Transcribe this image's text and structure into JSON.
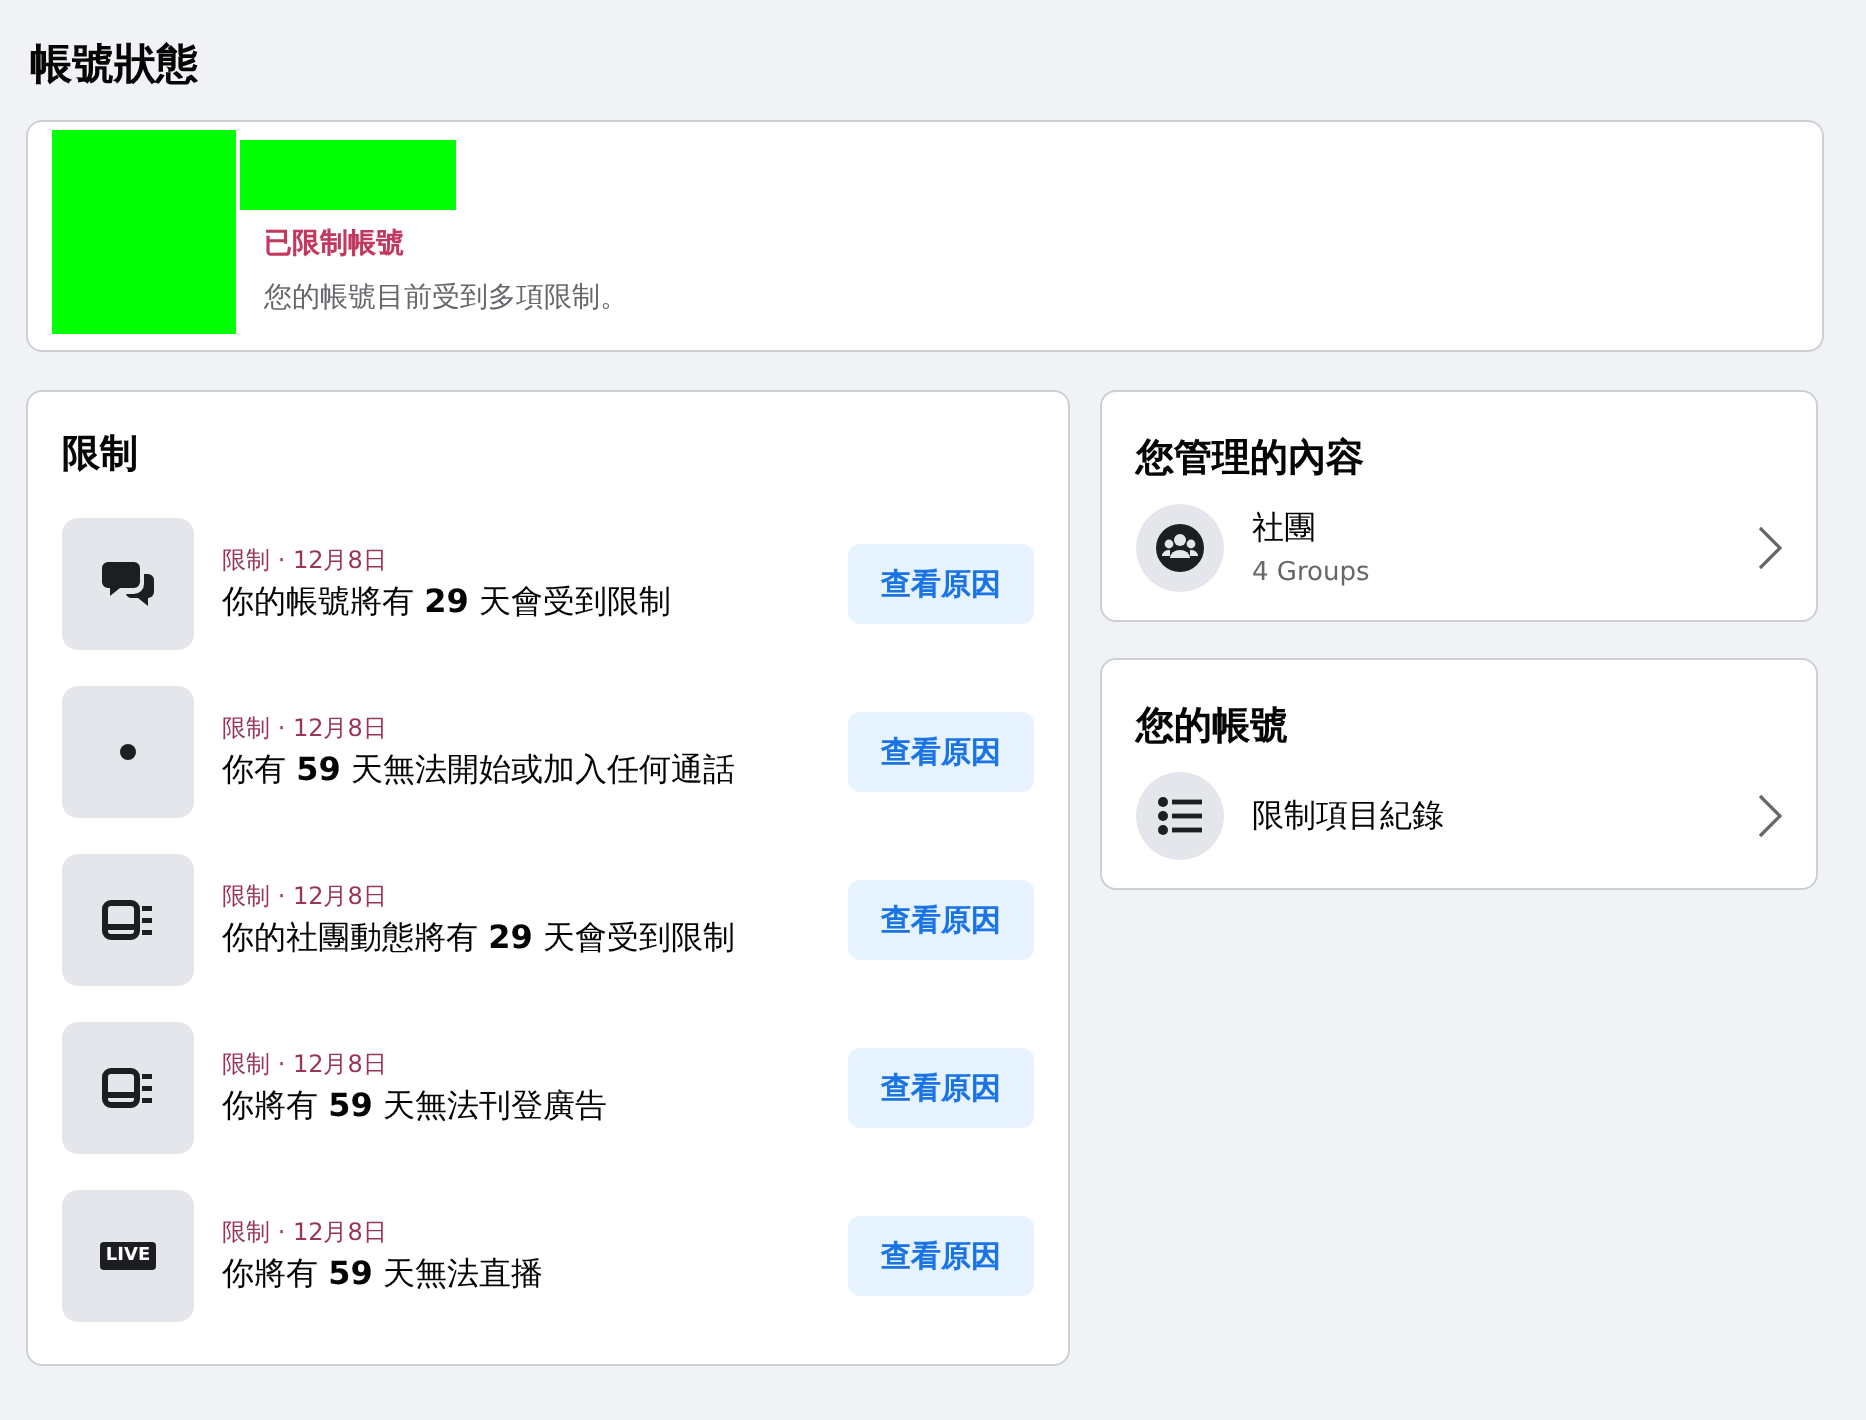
{
  "page_title": "帳號狀態",
  "account": {
    "status": "已限制帳號",
    "description": "您的帳號目前受到多項限制。"
  },
  "restrictions": {
    "title": "限制",
    "items": [
      {
        "kind": "chat",
        "meta": "限制 · 12月8日",
        "text": "你的帳號將有 **29** 天會受到限制",
        "button": "查看原因"
      },
      {
        "kind": "dot",
        "meta": "限制 · 12月8日",
        "text": "你有 **59** 天無法開始或加入任何通話",
        "button": "查看原因"
      },
      {
        "kind": "feed",
        "meta": "限制 · 12月8日",
        "text": "你的社團動態將有 **29** 天會受到限制",
        "button": "查看原因"
      },
      {
        "kind": "feed",
        "meta": "限制 · 12月8日",
        "text": "你將有 **59** 天無法刊登廣告",
        "button": "查看原因"
      },
      {
        "kind": "live",
        "badge": "LIVE",
        "meta": "限制 · 12月8日",
        "text": "你將有 **59** 天無法直播",
        "button": "查看原因"
      }
    ]
  },
  "managed_content": {
    "title": "您管理的內容",
    "items": [
      {
        "kind": "groups",
        "label": "社團",
        "sublabel": "4 Groups"
      }
    ]
  },
  "your_account": {
    "title": "您的帳號",
    "items": [
      {
        "kind": "list",
        "label": "限制項目紀錄"
      }
    ]
  }
}
